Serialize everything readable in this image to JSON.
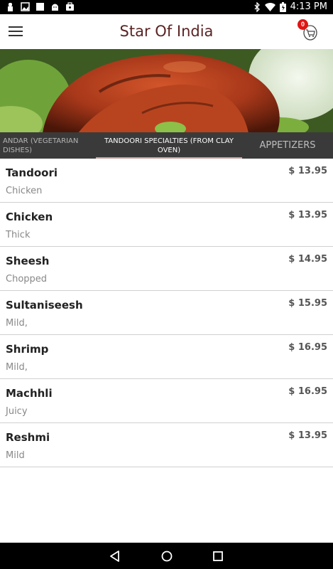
{
  "status_bar": {
    "time": "4:13 PM",
    "left_icons": [
      "notification-icon",
      "image-icon",
      "square-icon",
      "android-icon",
      "briefcase-icon"
    ],
    "right_icons": [
      "bluetooth-icon",
      "wifi-icon",
      "battery-icon"
    ]
  },
  "app_bar": {
    "title": "Star Of India",
    "cart_count": "0"
  },
  "tabs": [
    {
      "label": "ANDAR (VEGETARIAN DISHES)"
    },
    {
      "label": "TANDOORI SPECIALTIES (FROM CLAY OVEN)",
      "selected": true
    },
    {
      "label": "APPETIZERS"
    }
  ],
  "menu_items": [
    {
      "name": "Tandoori",
      "description": "Chicken",
      "price": "$ 13.95"
    },
    {
      "name": "Chicken",
      "description": "Thick",
      "price": "$ 13.95"
    },
    {
      "name": "Sheesh",
      "description": "Chopped",
      "price": "$ 14.95"
    },
    {
      "name": "Sultaniseesh",
      "description": "Mild,",
      "price": "$ 15.95"
    },
    {
      "name": "Shrimp",
      "description": "Mild,",
      "price": "$ 16.95"
    },
    {
      "name": "Machhli",
      "description": "Juicy",
      "price": "$ 16.95"
    },
    {
      "name": "Reshmi",
      "description": "Mild",
      "price": "$ 13.95"
    }
  ],
  "colors": {
    "title": "#5b2323",
    "tab_bar": "#3a3a3a",
    "badge": "#e01414"
  }
}
